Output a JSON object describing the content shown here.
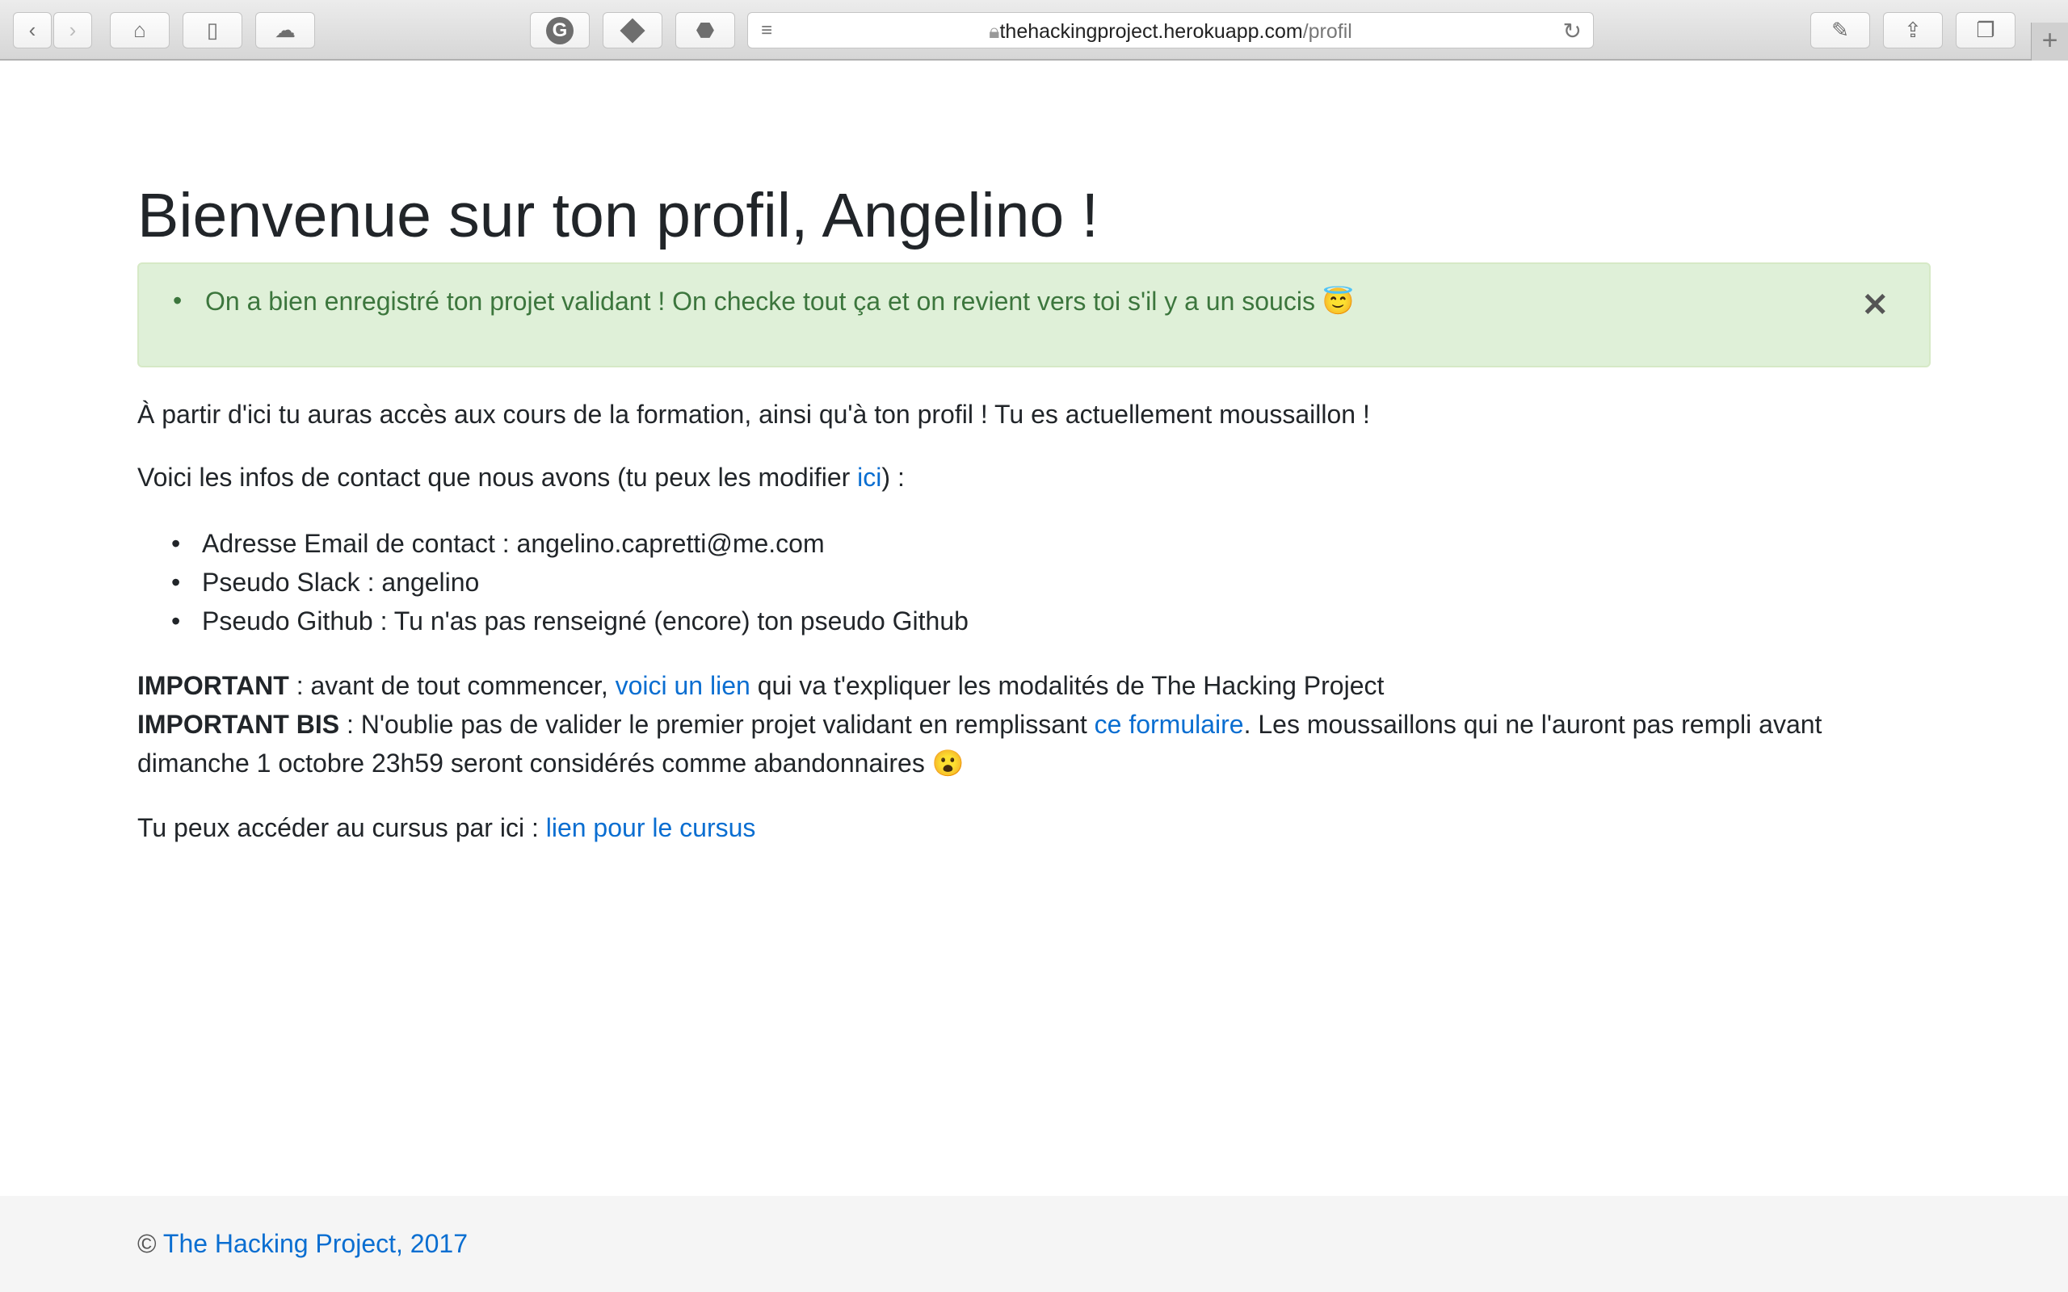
{
  "browser": {
    "url_host": "thehackingproject.herokuapp.com",
    "url_path": "/profil",
    "icons": [
      "back-icon",
      "forward-icon",
      "home-icon",
      "sidebar-icon",
      "cloud-icon",
      "grammarly-icon",
      "tag-icon",
      "adblock-icon",
      "reader-icon",
      "lock-icon",
      "reload-icon",
      "annotate-icon",
      "share-icon",
      "tabs-icon",
      "new-tab-icon"
    ]
  },
  "page": {
    "title": "Bienvenue sur ton profil, Angelino !",
    "alert": "On a bien enregistré ton projet validant ! On checke tout ça et on revient vers toi s'il y a un soucis 😇",
    "intro": "À partir d'ici tu auras accès aux cours de la formation, ainsi qu'à ton profil ! Tu es actuellement moussaillon !",
    "contact_prefix": "Voici les infos de contact que nous avons (tu peux les modifier ",
    "contact_link": "ici",
    "contact_suffix": ") :",
    "items": [
      "Adresse Email de contact : angelino.capretti@me.com",
      "Pseudo Slack : angelino",
      "Pseudo Github : Tu n'as pas renseigné (encore) ton pseudo Github"
    ],
    "important_label": "IMPORTANT",
    "important_prefix": " : avant de tout commencer, ",
    "important_link": "voici un lien",
    "important_suffix": " qui va t'expliquer les modalités de The Hacking Project",
    "important_bis_label": "IMPORTANT BIS",
    "important_bis_prefix": " : N'oublie pas de valider le premier projet validant en remplissant ",
    "important_bis_link": "ce formulaire",
    "important_bis_suffix": ". Les moussaillons qui ne l'auront pas rempli avant",
    "important_bis_line2": "dimanche 1 octobre 23h59 seront considérés comme abandonnaires 😮",
    "cursus_prefix": "Tu peux accéder au cursus par ici : ",
    "cursus_link": "lien pour le cursus"
  },
  "footer": {
    "copyright": "© ",
    "link": "The Hacking Project, 2017"
  }
}
